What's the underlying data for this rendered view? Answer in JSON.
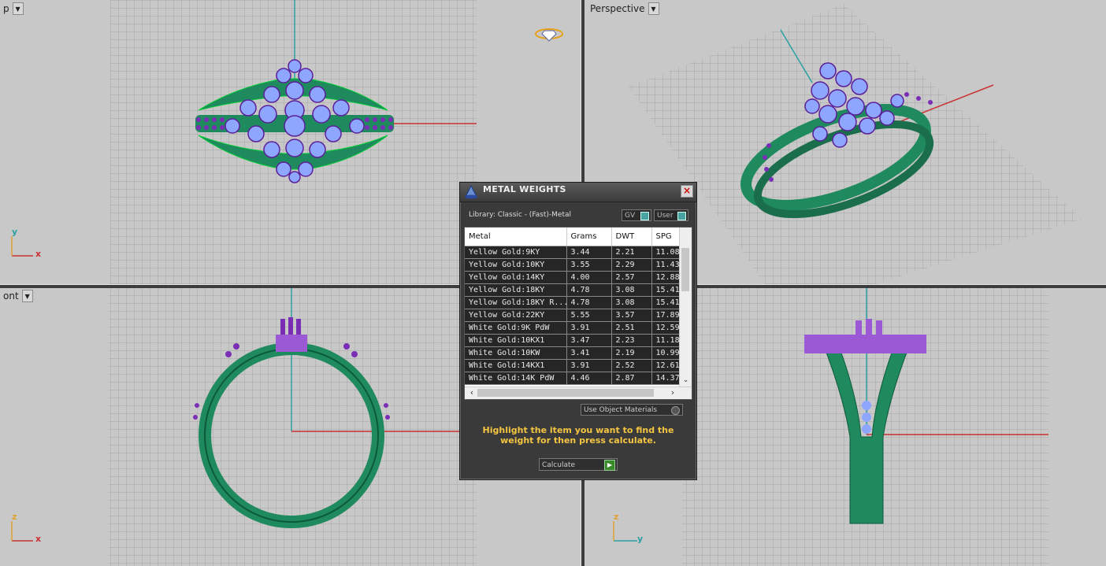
{
  "viewports": {
    "top": {
      "label": "p",
      "axis_h": "x",
      "axis_v": "y"
    },
    "perspective": {
      "label": "Perspective"
    },
    "front": {
      "label": "ont",
      "axis_h": "x",
      "axis_v": "z"
    },
    "right": {
      "axis_h": "y",
      "axis_v": "z"
    }
  },
  "dialog": {
    "title": "METAL WEIGHTS",
    "library": "Library: Classic - (Fast)-Metal",
    "toggle_gv": "GV",
    "toggle_user": "User",
    "columns": [
      "Metal",
      "Grams",
      "DWT",
      "SPG"
    ],
    "rows": [
      [
        "Yellow Gold:9KY",
        "3.44",
        "2.21",
        "11.08"
      ],
      [
        "Yellow Gold:10KY",
        "3.55",
        "2.29",
        "11.43"
      ],
      [
        "Yellow Gold:14KY",
        "4.00",
        "2.57",
        "12.88"
      ],
      [
        "Yellow Gold:18KY",
        "4.78",
        "3.08",
        "15.41"
      ],
      [
        "Yellow Gold:18KY R...",
        "4.78",
        "3.08",
        "15.41"
      ],
      [
        "Yellow Gold:22KY",
        "5.55",
        "3.57",
        "17.89"
      ],
      [
        "White Gold:9K PdW",
        "3.91",
        "2.51",
        "12.59"
      ],
      [
        "White Gold:10KX1",
        "3.47",
        "2.23",
        "11.18"
      ],
      [
        "White Gold:10KW",
        "3.41",
        "2.19",
        "10.99"
      ],
      [
        "White Gold:14KX1",
        "3.91",
        "2.52",
        "12.61"
      ],
      [
        "White Gold:14K PdW",
        "4.46",
        "2.87",
        "14.37"
      ]
    ],
    "use_object_materials": "Use Object Materials",
    "hint": "Highlight the item you want to find the weight for then press calculate.",
    "calculate": "Calculate"
  },
  "colors": {
    "metal": "#1f8a5e",
    "stone": "#8fa6ff",
    "prong": "#7a2db5",
    "axis_x": "#c83232",
    "axis_y": "#2aa0a0"
  }
}
